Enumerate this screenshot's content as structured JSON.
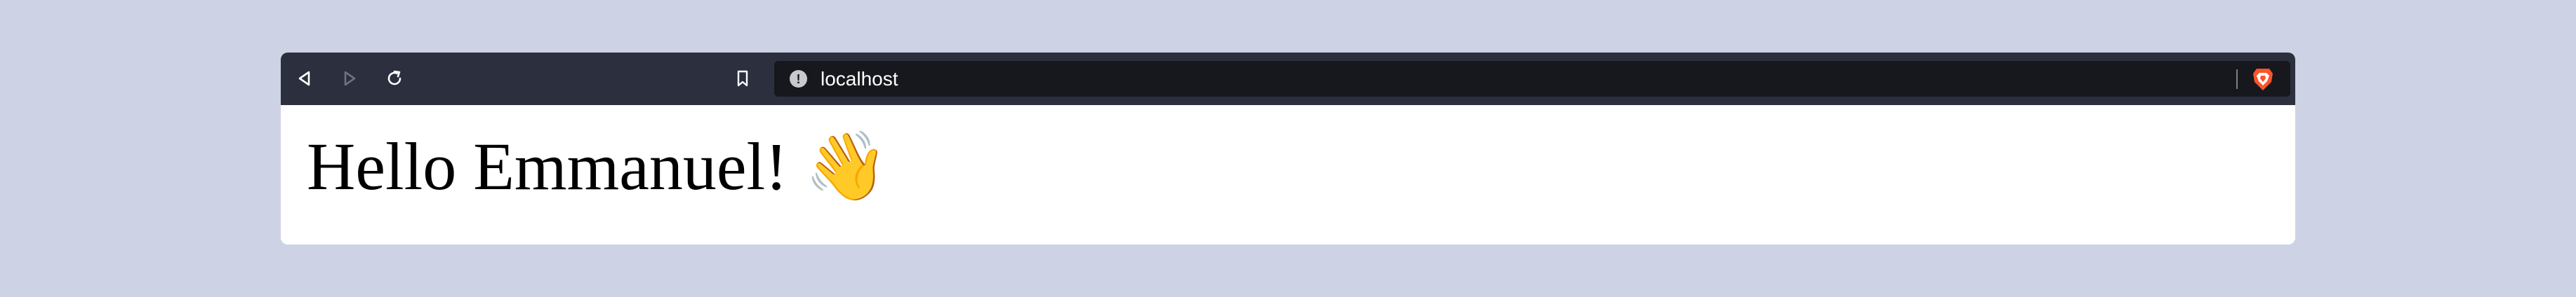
{
  "browser": {
    "address_bar": {
      "url": "localhost",
      "security_icon": "info-icon"
    },
    "toolbar": {
      "back_icon": "back-icon",
      "forward_icon": "forward-icon",
      "reload_icon": "reload-icon",
      "bookmark_icon": "bookmark-icon",
      "shields_icon": "brave-shields-icon"
    }
  },
  "page": {
    "heading": "Hello Emmanuel! 👋"
  },
  "colors": {
    "desktop_background": "#cdd3e5",
    "toolbar_background": "#2c2f3d",
    "address_bar_background": "#17181d",
    "brand_accent": "#fb542b"
  }
}
